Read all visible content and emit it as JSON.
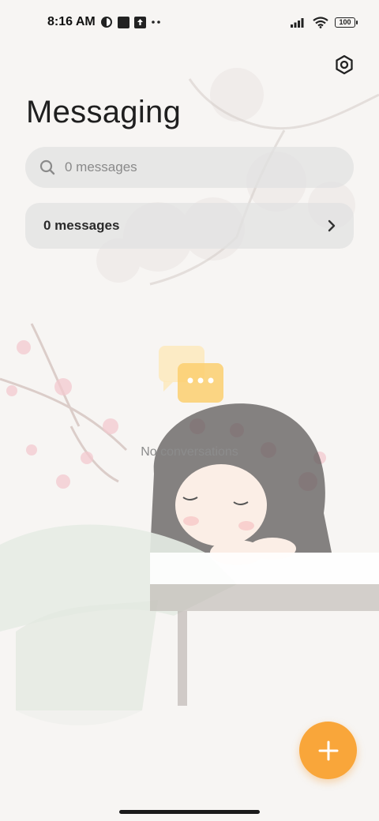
{
  "status_bar": {
    "time": "8:16 AM",
    "battery": "100",
    "icons": [
      "status-app-icon",
      "status-square-icon",
      "status-upload-icon",
      "more-dots-icon",
      "signal-icon",
      "wifi-icon",
      "battery-icon"
    ]
  },
  "header": {
    "title": "Messaging",
    "settings_icon": "settings-icon"
  },
  "search": {
    "placeholder": "0 messages",
    "icon": "search-icon"
  },
  "messages_card": {
    "label": "0 messages",
    "icon": "chevron-right-icon"
  },
  "empty_state": {
    "text": "No conversations",
    "icon": "chat-bubble-icon"
  },
  "fab": {
    "icon": "plus-icon"
  },
  "colors": {
    "accent": "#f9a63a",
    "background": "#f7f5f3",
    "card": "#e1e1e1"
  }
}
